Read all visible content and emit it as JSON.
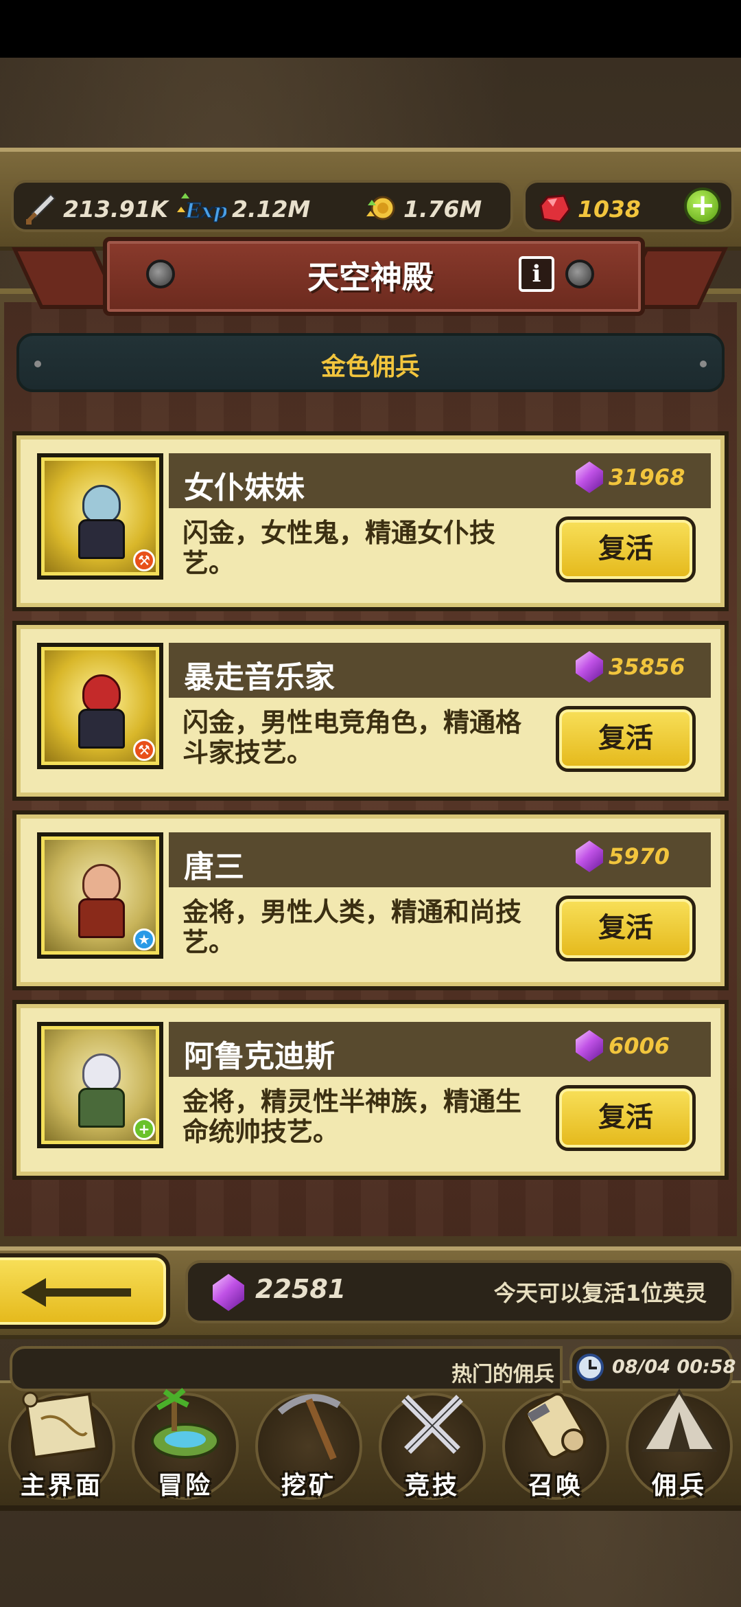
{
  "resources": {
    "attack": "213.91K",
    "exp_label": "Exp",
    "exp": "2.12M",
    "gold": "1.76M",
    "gems": "1038"
  },
  "header": {
    "title": "天空神殿",
    "info_label": "i"
  },
  "subtitle": "金色佣兵",
  "heroes": [
    {
      "name": "女仆妹妹",
      "cost": "31968",
      "desc": "闪金，女性鬼，精通女仆技艺。",
      "button": "复活",
      "badge_icon": "wrench-icon"
    },
    {
      "name": "暴走音乐家",
      "cost": "35856",
      "desc": "闪金，男性电竞角色，精通格斗家技艺。",
      "button": "复活",
      "badge_icon": "wrench-icon"
    },
    {
      "name": "唐三",
      "cost": "5970",
      "desc": "金将，男性人类，精通和尚技艺。",
      "button": "复活",
      "badge_icon": "star-icon"
    },
    {
      "name": "阿鲁克迪斯",
      "cost": "6006",
      "desc": "金将，精灵性半神族，精通生命统帅技艺。",
      "button": "复活",
      "badge_icon": "plus-icon"
    }
  ],
  "footer": {
    "total_gems": "22581",
    "note": "今天可以复活1位英灵"
  },
  "ticker": "热门的佣兵",
  "clock": "08/04 00:58",
  "nav": [
    {
      "label": "主界面",
      "icon": "map-scroll-icon"
    },
    {
      "label": "冒险",
      "icon": "island-icon"
    },
    {
      "label": "挖矿",
      "icon": "pickaxe-icon"
    },
    {
      "label": "竞技",
      "icon": "crossed-swords-icon"
    },
    {
      "label": "召唤",
      "icon": "summon-scroll-icon"
    },
    {
      "label": "佣兵",
      "icon": "tent-icon"
    }
  ],
  "colors": {
    "accent_gold": "#f2c53d",
    "card_bg": "#f2e8b0",
    "banner_red": "#8a3a2c",
    "button_yellow": "#f8e05a"
  }
}
